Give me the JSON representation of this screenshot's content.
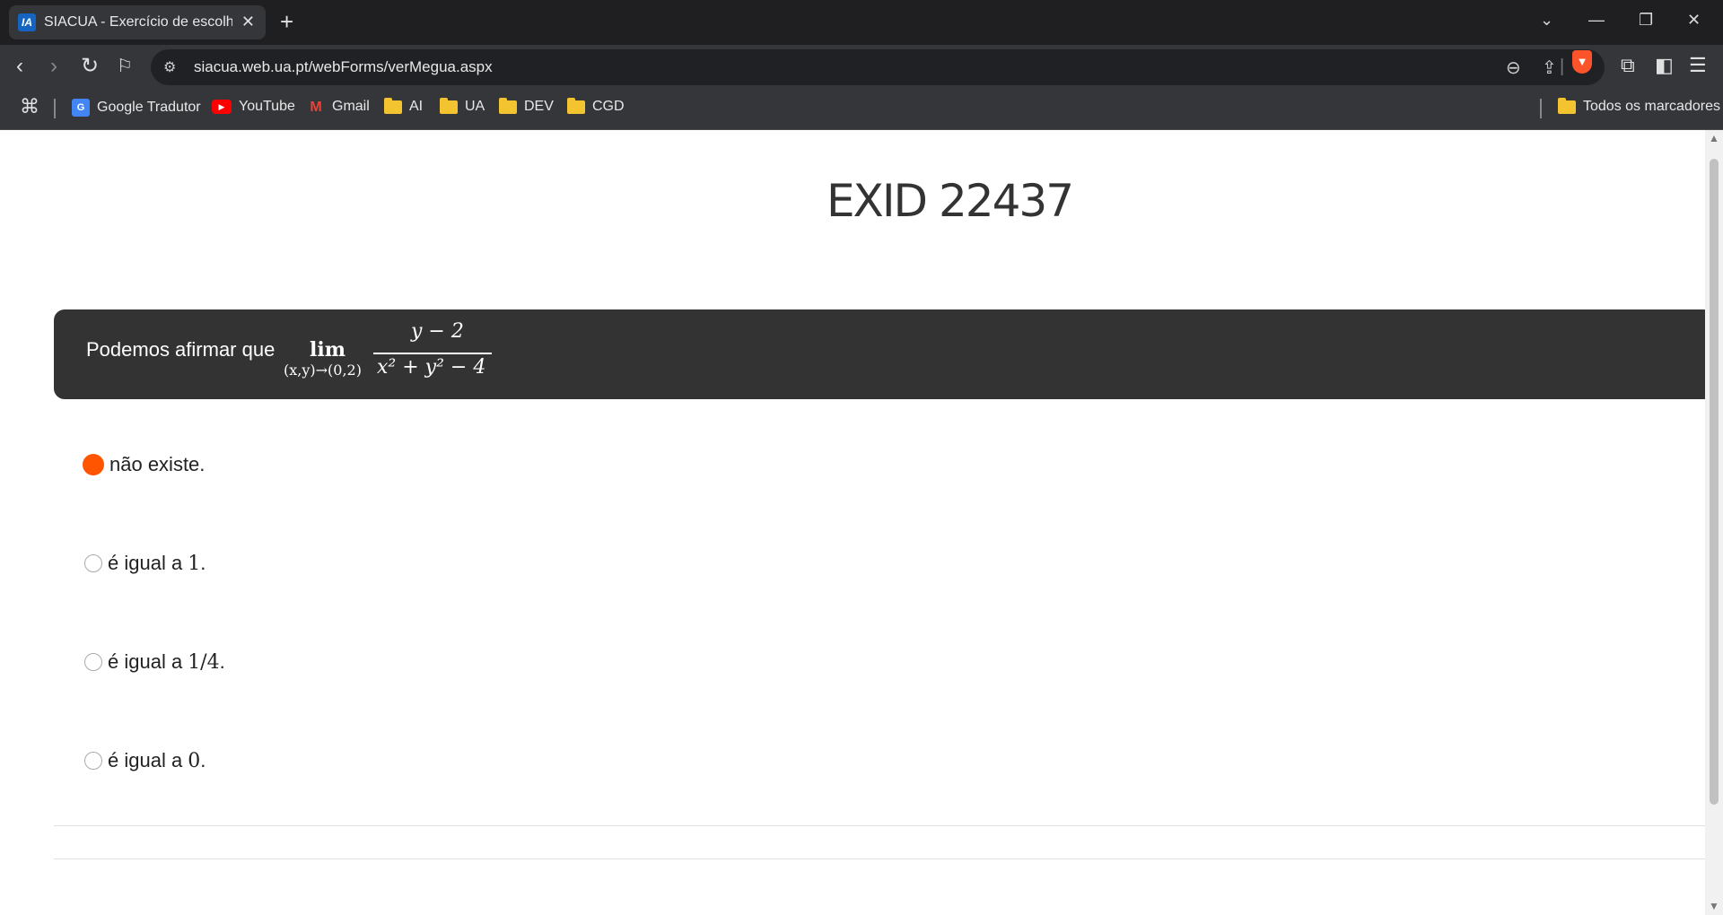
{
  "browser": {
    "tab_title": "SIACUA - Exercício de escolha múltipla",
    "tab_favicon": "IA",
    "url": "siacua.web.ua.pt/webForms/verMegua.aspx",
    "bookmarks": [
      {
        "label": "Google Tradutor",
        "icon": "google-translate-icon"
      },
      {
        "label": "YouTube",
        "icon": "youtube-icon"
      },
      {
        "label": "Gmail",
        "icon": "gmail-icon"
      },
      {
        "label": "AI",
        "icon": "folder-icon"
      },
      {
        "label": "UA",
        "icon": "folder-icon"
      },
      {
        "label": "DEV",
        "icon": "folder-icon"
      },
      {
        "label": "CGD",
        "icon": "folder-icon"
      }
    ],
    "all_bookmarks_label": "Todos os marcadores"
  },
  "exercise": {
    "title": "EXID 22437",
    "question_text": "Podemos afirmar que",
    "math": {
      "lim": "lim",
      "lim_sub": "(x,y)→(0,2)",
      "numerator": "y − 2",
      "denominator": "x² + y² − 4"
    },
    "options": [
      {
        "text": "não existe.",
        "math": "",
        "suffix": "",
        "selected": true
      },
      {
        "text": "é igual a",
        "math": "1",
        "suffix": ".",
        "selected": false
      },
      {
        "text": "é igual a",
        "math": "1/4",
        "suffix": ".",
        "selected": false
      },
      {
        "text": "é igual a",
        "math": "0",
        "suffix": ".",
        "selected": false
      }
    ]
  },
  "colors": {
    "selected_radio": "#ff5500",
    "question_bg": "#333333"
  }
}
